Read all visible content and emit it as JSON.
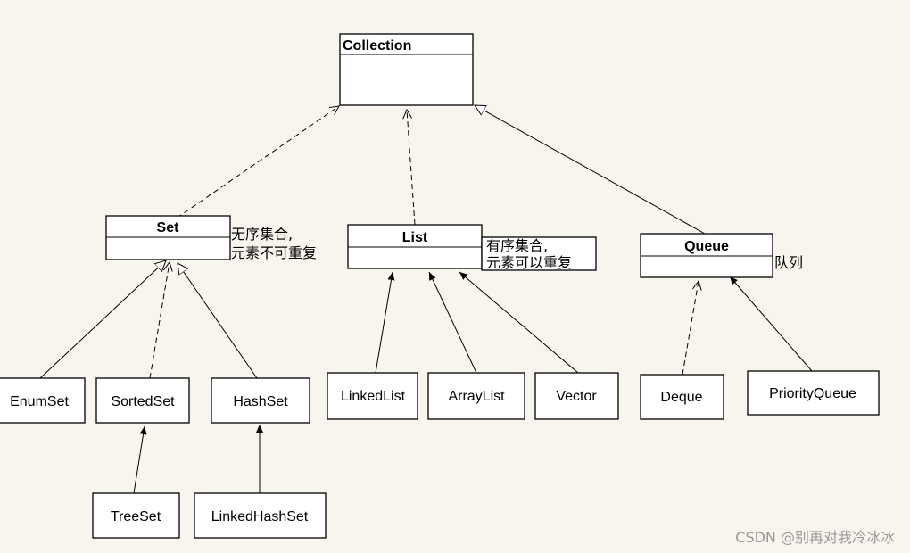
{
  "interfaces": {
    "collection": "Collection",
    "set": "Set",
    "list": "List",
    "queue": "Queue"
  },
  "notes": {
    "set_line1": "无序集合,",
    "set_line2": "元素不可重复",
    "list_line1": "有序集合,",
    "list_line2": "元素可以重复",
    "queue": "队列"
  },
  "classes": {
    "enumset": "EnumSet",
    "sortedset": "SortedSet",
    "hashset": "HashSet",
    "treeset": "TreeSet",
    "linkedhashset": "LinkedHashSet",
    "linkedlist": "LinkedList",
    "arraylist": "ArrayList",
    "vector": "Vector",
    "deque": "Deque",
    "priorityqueue": "PriorityQueue"
  },
  "watermark": "CSDN @别再对我冷冰冰",
  "colors": {
    "background": "#f8f5ee",
    "watermark": "#9a9a9a"
  }
}
